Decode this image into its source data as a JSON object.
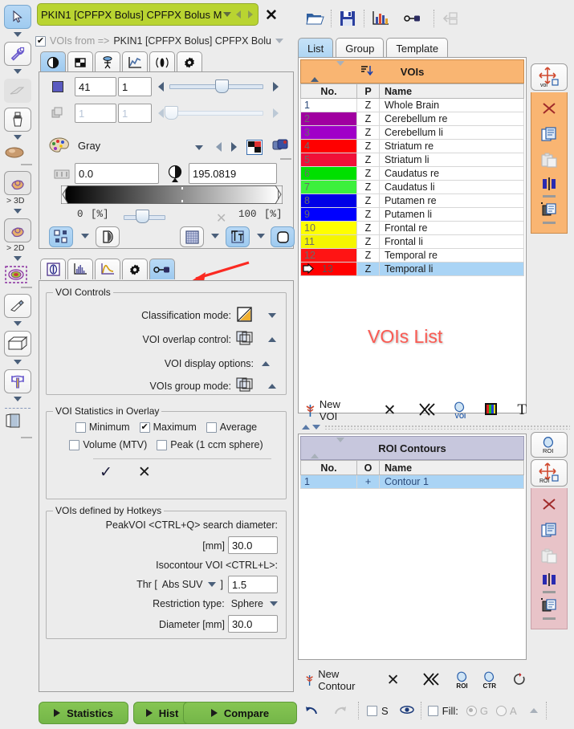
{
  "window": {
    "study_title": "PKIN1 [CPFPX Bolus] CPFPX Bolus M",
    "close_icon": "close-icon"
  },
  "voi_from": {
    "checkbox_checked": true,
    "label": "VOIs from =>",
    "value": "PKIN1 [CPFPX Bolus] CPFPX Bolu"
  },
  "left_toolbar": {
    "items": [
      {
        "name": "pointer-tool",
        "icon": "cursor-arrow-icon",
        "selected": true
      },
      {
        "name": "wrench-tool",
        "icon": "wrench-icon",
        "selected": false
      },
      {
        "name": "scalpel-tool",
        "icon": "scalpel-icon",
        "selected": false,
        "disabled": true
      },
      {
        "name": "brush-tool",
        "icon": "paintbrush-icon",
        "selected": false
      },
      {
        "name": "blob-tool",
        "icon": "ellipse-blob-icon",
        "selected": false
      },
      {
        "name": "paint-3d-tool",
        "icon": "paint-bucket-icon",
        "label": "> 3D",
        "selected": false
      },
      {
        "name": "paint-2d-tool",
        "icon": "paint-bucket-icon",
        "label": "> 2D",
        "selected": false
      },
      {
        "name": "isocontour-tool",
        "icon": "target-dashed-icon",
        "selected": false
      },
      {
        "name": "eraser-tool",
        "icon": "eraser-icon",
        "selected": false
      },
      {
        "name": "box-tool",
        "icon": "cube-icon",
        "selected": false
      },
      {
        "name": "hammer-tool",
        "icon": "hammer-icon",
        "selected": false
      },
      {
        "name": "notebook-tool",
        "icon": "notebook-icon",
        "selected": false
      }
    ]
  },
  "image_tabs": [
    {
      "name": "tab-contrast",
      "icon": "contrast-circle-icon",
      "selected": true
    },
    {
      "name": "tab-layout",
      "icon": "grid-window-icon",
      "selected": false
    },
    {
      "name": "tab-fusion",
      "icon": "fusion-icon",
      "selected": false
    },
    {
      "name": "tab-curve",
      "icon": "curve-chart-icon",
      "selected": false
    },
    {
      "name": "tab-kinetics",
      "icon": "radial-waves-icon",
      "selected": false
    },
    {
      "name": "tab-settings",
      "icon": "gear-icon",
      "selected": false
    }
  ],
  "image_controls": {
    "slice_value": "41",
    "slice_step": "1",
    "frame_value": "1",
    "frame_step": "1",
    "frame_disabled": true,
    "colortable_name": "Gray",
    "min_value": "0.0",
    "max_value": "195.0819",
    "pct_min": "0",
    "pct_min_unit": "[%]",
    "pct_max": "100",
    "pct_max_unit": "[%]",
    "palette_icon": "palette-icon",
    "prev_icon": "triangle-left-icon",
    "next_icon": "triangle-right-icon",
    "invert_icon": "invert-colors-icon",
    "copy_lut_icon": "copy-colortable-icon",
    "range_icon": "range-icon",
    "threshold_icon": "threshold-half-circle-icon",
    "reset_icon": "close-x-icon",
    "bottom_icons": [
      {
        "name": "markers-toggle",
        "icon": "markers-icon",
        "selected": true
      },
      {
        "name": "markers-menu",
        "icon": "chevron-down-icon",
        "selected": false
      },
      {
        "name": "alpha-blend",
        "icon": "half-shaded-circle-icon",
        "selected": false
      },
      {
        "name": "grid-toggle",
        "icon": "fine-grid-icon",
        "selected": false
      },
      {
        "name": "grid-menu",
        "icon": "chevron-down-icon",
        "selected": false
      },
      {
        "name": "annotation-toggle",
        "icon": "text-overlay-icon",
        "selected": true
      },
      {
        "name": "annotation-menu",
        "icon": "chevron-down-icon",
        "selected": false
      },
      {
        "name": "outline-toggle",
        "icon": "rounded-square-icon",
        "selected": true
      }
    ]
  },
  "voi_tabs": [
    {
      "name": "tab-info",
      "icon": "info-circle-icon",
      "selected": false
    },
    {
      "name": "tab-histogram",
      "icon": "histogram-icon",
      "selected": false
    },
    {
      "name": "tab-tac",
      "icon": "tac-curve-icon",
      "selected": false
    },
    {
      "name": "tab-voi-settings",
      "icon": "gear-icon",
      "selected": false
    },
    {
      "name": "tab-voi-controls",
      "icon": "switch-icon",
      "selected": true
    }
  ],
  "voi_controls": {
    "group_title": "VOI Controls",
    "rows": [
      {
        "label": "Classification mode:",
        "icon": "triangle-fill-icon",
        "chevron": "down",
        "has_icon": true
      },
      {
        "label": "VOI overlap control:",
        "icon": "overlap-squares-icon",
        "chevron": "up",
        "has_icon": true
      },
      {
        "label": "VOI display options:",
        "icon": "",
        "chevron": "up",
        "has_icon": false
      },
      {
        "label": "VOIs group mode:",
        "icon": "overlap-squares-icon",
        "chevron": "up",
        "has_icon": true
      }
    ]
  },
  "voi_stats": {
    "group_title": "VOI Statistics in Overlay",
    "checkboxes": [
      {
        "label": "Minimum",
        "checked": false
      },
      {
        "label": "Maximum",
        "checked": true
      },
      {
        "label": "Average",
        "checked": false
      },
      {
        "label": "Volume (MTV)",
        "checked": false
      },
      {
        "label": "Peak (1 ccm sphere)",
        "checked": false
      }
    ],
    "confirm_icon": "checkmark-icon",
    "cancel_icon": "close-x-icon"
  },
  "hotkeys": {
    "group_title": "VOIs defined by Hotkeys",
    "peakvoi_label": "PeakVOI <CTRL+Q> search diameter:",
    "mm_label": "[mm]",
    "peakvoi_value": "30.0",
    "isocontour_label": "Isocontour VOI <CTRL+L>:",
    "thr_prefix": "Thr [",
    "thr_mode": "Abs SUV",
    "thr_suffix": "]",
    "thr_value": "1.5",
    "restriction_label": "Restriction type:",
    "restriction_value": "Sphere",
    "diameter_label": "Diameter [mm]",
    "diameter_value": "30.0"
  },
  "bottom_buttons": [
    {
      "label": "Statistics",
      "name": "statistics-button"
    },
    {
      "label": "Hist",
      "name": "hist-button"
    },
    {
      "label": "Compare",
      "name": "compare-button"
    }
  ],
  "top_toolbar": [
    {
      "name": "open-button",
      "icon": "open-folder-icon",
      "disabled": false
    },
    {
      "name": "save-button",
      "icon": "floppy-save-icon",
      "disabled": false
    },
    {
      "name": "chart-button",
      "icon": "bar-chart-icon",
      "disabled": false
    },
    {
      "name": "switch-button",
      "icon": "switch-icon",
      "disabled": false
    },
    {
      "name": "transfer-button",
      "icon": "transfer-back-icon",
      "disabled": true
    }
  ],
  "right_tabs": [
    {
      "label": "List",
      "selected": true
    },
    {
      "label": "Group",
      "selected": false
    },
    {
      "label": "Template",
      "selected": false
    }
  ],
  "vois_panel": {
    "title": "VOIs",
    "up_icon": "triangle-up-icon",
    "down_icon": "triangle-down-icon",
    "sort_icon": "sort-descending-icon",
    "watermark": "VOIs List",
    "columns": [
      "No.",
      "P",
      "Name"
    ],
    "rows": [
      {
        "no": "1",
        "p": "Z",
        "name": "Whole Brain",
        "color": "#ffffff",
        "selected": false,
        "marker": false
      },
      {
        "no": "2",
        "p": "Z",
        "name": "Cerebellum re",
        "color": "#a000a0",
        "selected": false,
        "marker": false
      },
      {
        "no": "3",
        "p": "Z",
        "name": "Cerebellum li",
        "color": "#a000c8",
        "selected": false,
        "marker": false
      },
      {
        "no": "4",
        "p": "Z",
        "name": "Striatum re",
        "color": "#ff0000",
        "selected": false,
        "marker": false
      },
      {
        "no": "5",
        "p": "Z",
        "name": "Striatum li",
        "color": "#f01038",
        "selected": false,
        "marker": false
      },
      {
        "no": "6",
        "p": "Z",
        "name": "Caudatus re",
        "color": "#00e000",
        "selected": false,
        "marker": false
      },
      {
        "no": "7",
        "p": "Z",
        "name": "Caudatus li",
        "color": "#3cf03c",
        "selected": false,
        "marker": false
      },
      {
        "no": "8",
        "p": "Z",
        "name": "Putamen re",
        "color": "#0000e6",
        "selected": false,
        "marker": false
      },
      {
        "no": "9",
        "p": "Z",
        "name": "Putamen li",
        "color": "#0000ff",
        "selected": false,
        "marker": false
      },
      {
        "no": "10",
        "p": "Z",
        "name": "Frontal re",
        "color": "#ffff00",
        "selected": false,
        "marker": false
      },
      {
        "no": "11",
        "p": "Z",
        "name": "Frontal li",
        "color": "#f5f500",
        "selected": false,
        "marker": false
      },
      {
        "no": "12",
        "p": "Z",
        "name": "Temporal re",
        "color": "#ff1414",
        "selected": false,
        "marker": false
      },
      {
        "no": "13",
        "p": "Z",
        "name": "Temporal li",
        "color": "#ff0000",
        "selected": true,
        "marker": true
      }
    ],
    "side_buttons": [
      {
        "name": "voi-move-button",
        "icon": "move-voi-icon",
        "label": "voi"
      },
      {
        "name": "voi-delete-button",
        "icon": "delete-x-icon"
      },
      {
        "name": "voi-copy-button",
        "icon": "copy-icon"
      },
      {
        "name": "voi-paste-button",
        "icon": "paste-icon",
        "disabled": true
      },
      {
        "name": "voi-mirror-button",
        "icon": "mirror-icon"
      },
      {
        "name": "voi-add-copy-button",
        "icon": "add-copy-icon"
      }
    ],
    "toolbar": [
      {
        "name": "new-voi-button",
        "label": "New VOI",
        "icon": "new-voi-icon"
      },
      {
        "name": "delete-voi-button",
        "icon": "close-x-icon"
      },
      {
        "name": "delete-all-voi-button",
        "icon": "double-x-icon"
      },
      {
        "name": "voi-convert-button",
        "icon": "voi-blob-icon",
        "sub": "VOI"
      },
      {
        "name": "voi-color-button",
        "icon": "color-swatch-icon"
      },
      {
        "name": "voi-text-button",
        "icon": "text-t-icon"
      }
    ]
  },
  "roi_panel": {
    "title": "ROI Contours",
    "up_icon": "triangle-up-icon",
    "down_icon": "triangle-down-icon",
    "columns": [
      "No.",
      "O",
      "Name"
    ],
    "rows": [
      {
        "no": "1",
        "o": "+",
        "name": "Contour 1",
        "selected": true
      }
    ],
    "side_buttons": [
      {
        "name": "roi-new-button",
        "icon": "roi-blob-icon",
        "label": "ROI"
      },
      {
        "name": "roi-move-button",
        "icon": "move-roi-icon",
        "label": "ROI"
      },
      {
        "name": "roi-delete-button",
        "icon": "delete-x-icon"
      },
      {
        "name": "roi-copy-button",
        "icon": "copy-icon"
      },
      {
        "name": "roi-paste-button",
        "icon": "paste-icon",
        "disabled": true
      },
      {
        "name": "roi-mirror-button",
        "icon": "mirror-icon"
      },
      {
        "name": "roi-add-copy-button",
        "icon": "add-copy-icon"
      }
    ],
    "toolbar": [
      {
        "name": "new-contour-button",
        "label": "New Contour",
        "icon": "new-contour-icon"
      },
      {
        "name": "delete-contour-button",
        "icon": "close-x-icon"
      },
      {
        "name": "delete-all-contour-button",
        "icon": "double-x-icon"
      },
      {
        "name": "contour-to-roi-button",
        "icon": "roi-blob-icon",
        "sub": "ROI"
      },
      {
        "name": "contour-ctr-button",
        "icon": "ctr-blob-icon",
        "sub": "CTR"
      },
      {
        "name": "contour-undo-button",
        "icon": "reset-contour-icon"
      }
    ]
  },
  "status_bar": {
    "undo_icon": "undo-arrow-icon",
    "redo_icon": "redo-arrow-icon",
    "s_checkbox": {
      "label": "S",
      "checked": false
    },
    "eye_icon": "visibility-icon",
    "fill_checkbox": {
      "label": "Fill:",
      "checked": false
    },
    "radios": [
      {
        "label": "G",
        "checked": true
      },
      {
        "label": "A",
        "checked": false
      }
    ],
    "expand_icon": "triangle-up-icon"
  },
  "colors": {
    "accent_green": "#b9d431",
    "panel_orange": "#f9b572",
    "panel_lavender": "#c7c7dd",
    "panel_pink": "#e8c3c8",
    "selection_blue": "#aad4f5",
    "button_green": "#86c553",
    "watermark_red": "#fb5a52"
  }
}
